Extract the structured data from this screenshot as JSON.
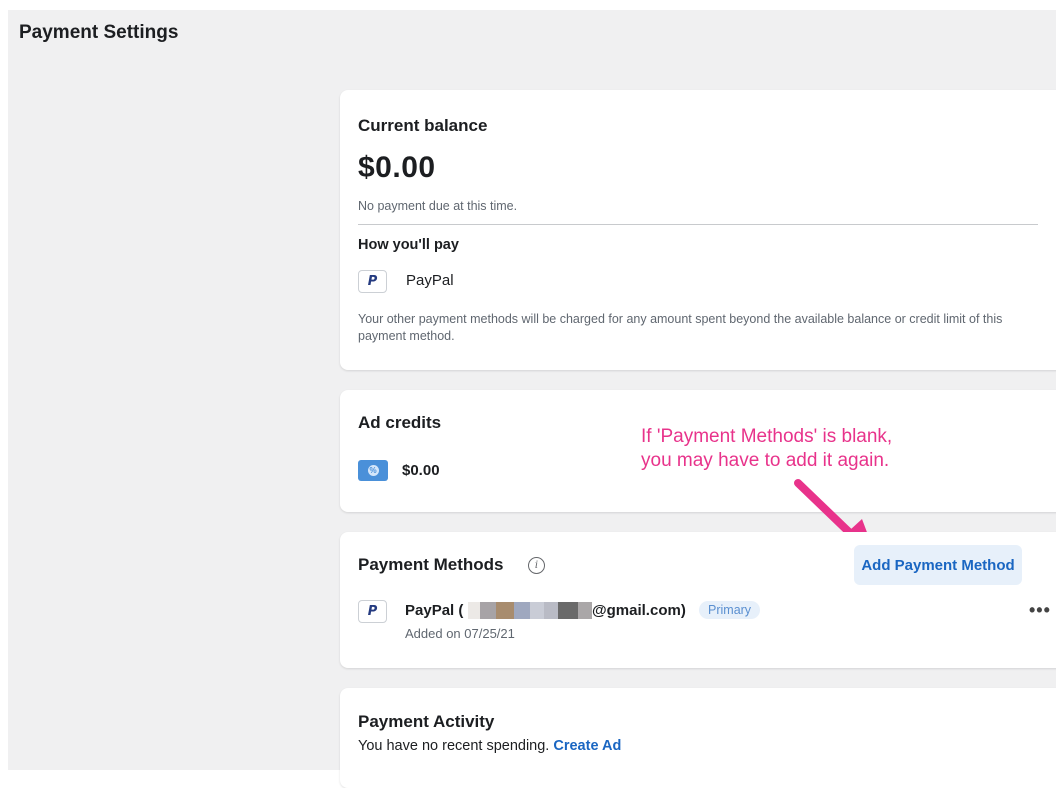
{
  "page": {
    "title": "Payment Settings"
  },
  "balance": {
    "heading": "Current balance",
    "amount": "$0.00",
    "status": "No payment due at this time.",
    "how_heading": "How you'll pay",
    "method_name": "PayPal",
    "method_icon": "paypal-icon",
    "note": "Your other payment methods will be charged for any amount spent beyond the available balance or credit limit of this payment method."
  },
  "credits": {
    "heading": "Ad credits",
    "icon": "ad-credit-icon",
    "amount": "$0.00"
  },
  "annotation": {
    "line1": "If 'Payment Methods' is blank,",
    "line2": "you may have to add it again.",
    "color": "#e8338b"
  },
  "methods": {
    "heading": "Payment Methods",
    "add_label": "Add Payment Method",
    "items": [
      {
        "name_prefix": "PayPal (",
        "name_suffix": "@gmail.com)",
        "badge": "Primary",
        "added": "Added on 07/25/21",
        "more": "•••"
      }
    ]
  },
  "activity": {
    "heading": "Payment Activity",
    "text": "You have no recent spending.",
    "link": "Create Ad"
  },
  "colors": {
    "accent": "#1a66c2",
    "button_bg": "#e7f0fa",
    "page_bg": "#f0f0f1"
  }
}
